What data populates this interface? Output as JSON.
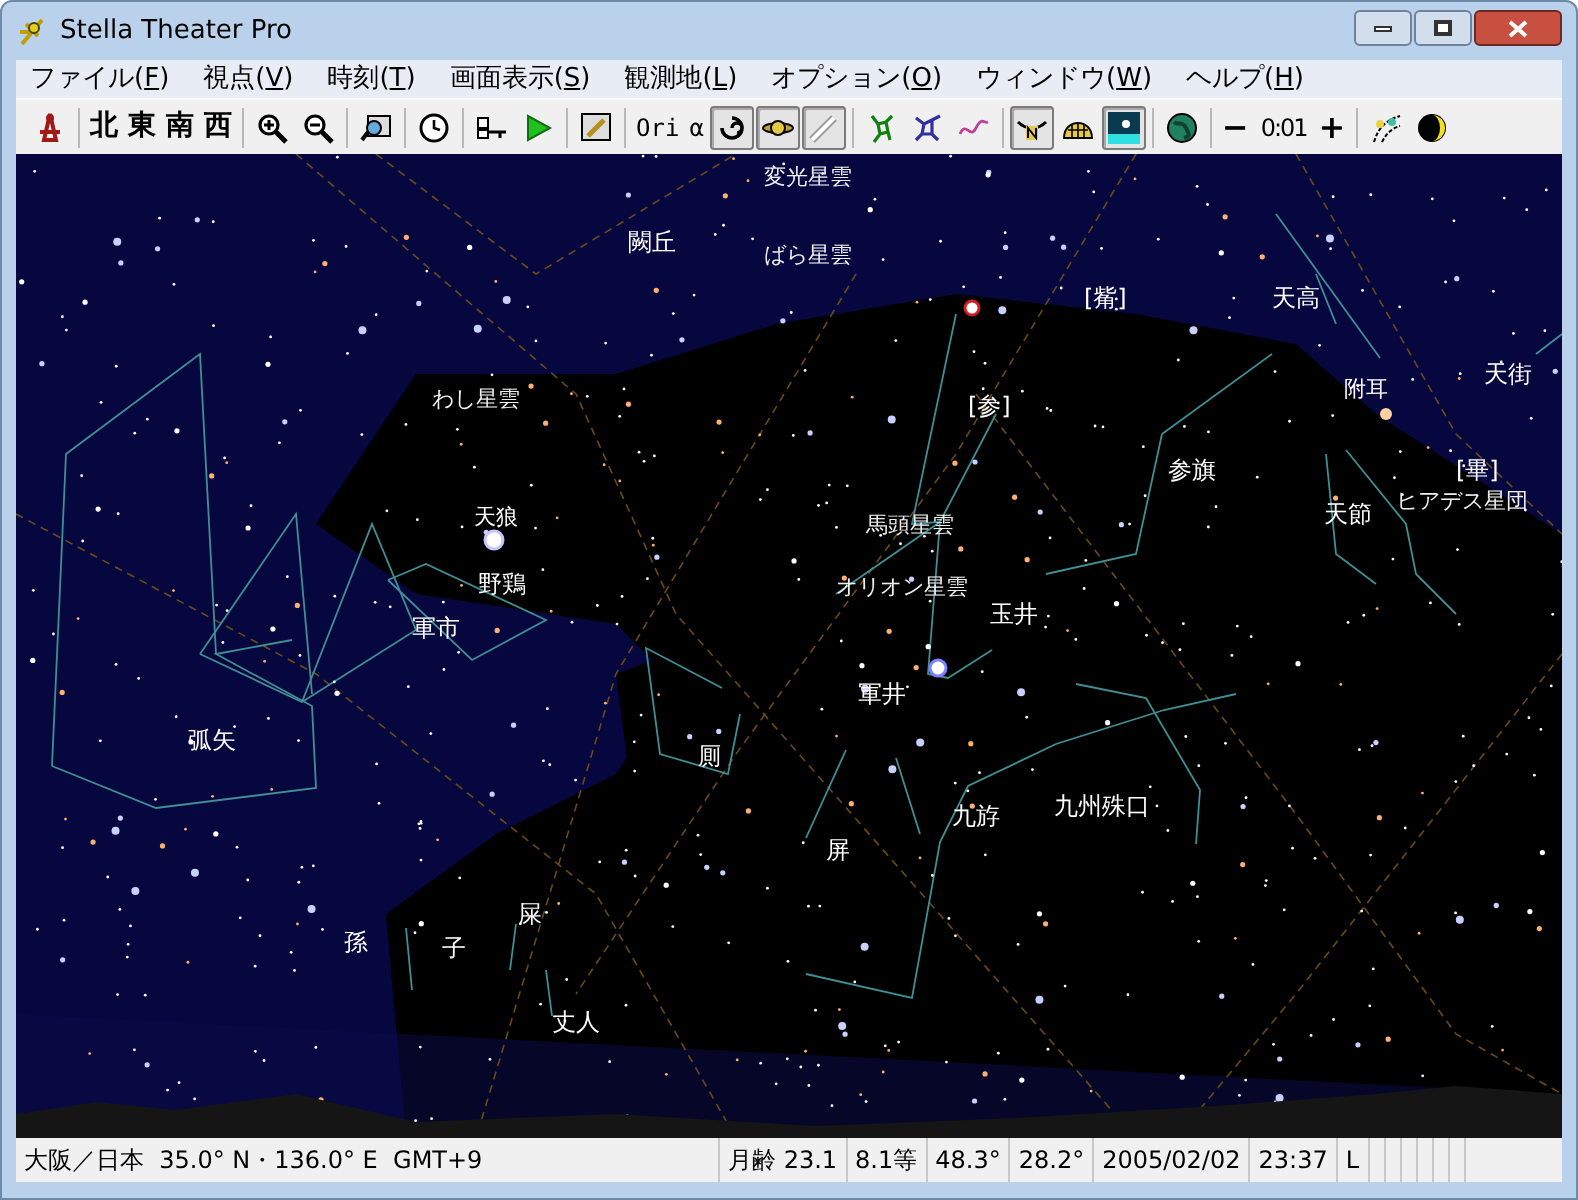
{
  "window": {
    "title": "Stella Theater Pro"
  },
  "menu": [
    {
      "text": "ファイル(",
      "accel": "F",
      "after": ")"
    },
    {
      "text": "視点(",
      "accel": "V",
      "after": ")"
    },
    {
      "text": "時刻(",
      "accel": "T",
      "after": ")"
    },
    {
      "text": "画面表示(",
      "accel": "S",
      "after": ")"
    },
    {
      "text": "観測地(",
      "accel": "L",
      "after": ")"
    },
    {
      "text": "オプション(",
      "accel": "O",
      "after": ")"
    },
    {
      "text": "ウィンドウ(",
      "accel": "W",
      "after": ")"
    },
    {
      "text": "ヘルプ(",
      "accel": "H",
      "after": ")"
    }
  ],
  "toolbar": [
    [
      {
        "kind": "icon",
        "selected": false
      }
    ],
    [
      {
        "kind": "text",
        "text": "北"
      },
      {
        "kind": "text",
        "text": "東"
      },
      {
        "kind": "text",
        "text": "南"
      },
      {
        "kind": "text",
        "text": "西"
      }
    ],
    [
      {
        "kind": "icon",
        "selected": false
      },
      {
        "kind": "icon",
        "selected": false
      }
    ],
    [
      {
        "kind": "icon",
        "selected": false
      }
    ],
    [
      {
        "kind": "icon",
        "selected": false
      }
    ],
    [
      {
        "kind": "icon",
        "selected": false
      },
      {
        "kind": "icon",
        "selected": false
      }
    ],
    [
      {
        "kind": "icon",
        "selected": false
      }
    ],
    [
      {
        "kind": "text",
        "text": "Ori"
      },
      {
        "kind": "text",
        "text": "α"
      },
      {
        "kind": "icon",
        "selected": true
      },
      {
        "kind": "icon",
        "selected": true
      },
      {
        "kind": "icon",
        "selected": true
      }
    ],
    [
      {
        "kind": "icon",
        "selected": false
      },
      {
        "kind": "icon",
        "selected": false
      },
      {
        "kind": "icon",
        "selected": false
      }
    ],
    [
      {
        "kind": "icon",
        "selected": true
      },
      {
        "kind": "icon",
        "selected": false
      },
      {
        "kind": "icon",
        "selected": true
      }
    ],
    [
      {
        "kind": "icon",
        "selected": false
      }
    ],
    [
      {
        "kind": "text",
        "text": "−"
      },
      {
        "kind": "readout",
        "text": "0:01"
      },
      {
        "kind": "text",
        "text": "+"
      }
    ],
    [
      {
        "kind": "icon",
        "selected": false
      },
      {
        "kind": "icon",
        "selected": false
      }
    ]
  ],
  "sky_labels": [
    {
      "text": "変光星雲",
      "kind": "object"
    },
    {
      "text": "闕丘",
      "kind": "constellation"
    },
    {
      "text": "ばら星雲",
      "kind": "object"
    },
    {
      "text": "[觜]",
      "kind": "constellation"
    },
    {
      "text": "天高",
      "kind": "constellation"
    },
    {
      "text": "わし星雲",
      "kind": "object"
    },
    {
      "text": "[参]",
      "kind": "constellation"
    },
    {
      "text": "附耳",
      "kind": "star"
    },
    {
      "text": "天街",
      "kind": "constellation"
    },
    {
      "text": "参旗",
      "kind": "constellation"
    },
    {
      "text": "[畢]",
      "kind": "constellation"
    },
    {
      "text": "天狼",
      "kind": "star"
    },
    {
      "text": "馬頭星雲",
      "kind": "object"
    },
    {
      "text": "天節",
      "kind": "constellation"
    },
    {
      "text": "ヒアデス星団",
      "kind": "object"
    },
    {
      "text": "野鶏",
      "kind": "constellation"
    },
    {
      "text": "オリオン星雲",
      "kind": "object"
    },
    {
      "text": "軍市",
      "kind": "constellation"
    },
    {
      "text": "玉井",
      "kind": "constellation"
    },
    {
      "text": "軍井",
      "kind": "constellation"
    },
    {
      "text": "弧矢",
      "kind": "constellation"
    },
    {
      "text": "厠",
      "kind": "constellation"
    },
    {
      "text": "九斿",
      "kind": "constellation"
    },
    {
      "text": "九州殊口",
      "kind": "constellation"
    },
    {
      "text": "屏",
      "kind": "constellation"
    },
    {
      "text": "屎",
      "kind": "constellation"
    },
    {
      "text": "孫",
      "kind": "constellation"
    },
    {
      "text": "子",
      "kind": "constellation"
    },
    {
      "text": "丈人",
      "kind": "constellation"
    }
  ],
  "status_bar": [
    "大阪／日本  35.0° N・136.0° E  GMT+9",
    "月齢 23.1",
    "8.1等",
    "48.3°",
    "28.2°",
    "2005/02/02",
    "23:37",
    "L"
  ]
}
